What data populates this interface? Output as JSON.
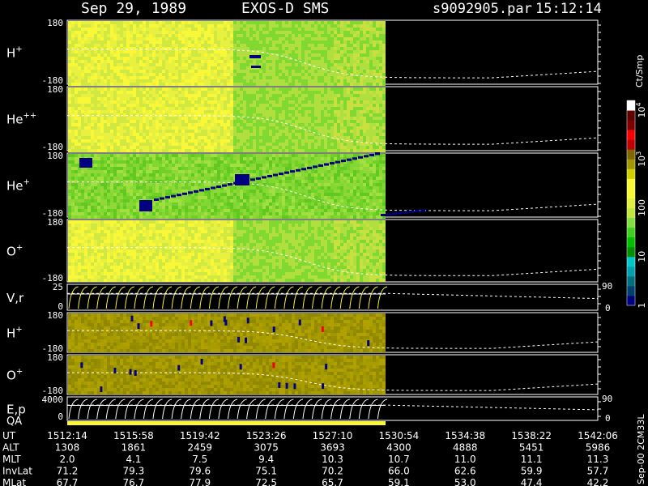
{
  "chart_data": {
    "type": "heatmap",
    "header": {
      "date": "Sep 29, 1989",
      "instrument": "EXOS-D SMS",
      "file": "s9092905.par",
      "time": "15:12:14"
    },
    "colorbar": {
      "label": "Ct/Smp",
      "ticks": [
        {
          "label": "1",
          "value": 1
        },
        {
          "label": "10",
          "value": 10
        },
        {
          "label": "100",
          "value": 100
        },
        {
          "label": "10",
          "sup": "3",
          "value": 1000
        },
        {
          "label": "10",
          "sup": "4",
          "value": 10000
        }
      ],
      "colors": [
        "#000080",
        "#004070",
        "#007080",
        "#00a0b0",
        "#00c8c8",
        "#009000",
        "#00c000",
        "#40d020",
        "#80e040",
        "#c0e840",
        "#e0f040",
        "#f8f838",
        "#f8f838",
        "#d0d000",
        "#a09800",
        "#806800",
        "#c00000",
        "#f80000",
        "#800000",
        "#600000",
        "#ffffff"
      ]
    },
    "panels": [
      {
        "id": "H+",
        "label": "H",
        "sup": "+",
        "ytop": "180",
        "ybot": "-180",
        "style": "yellow-green",
        "dense_dots": true
      },
      {
        "id": "He++",
        "label": "He",
        "sup": "++",
        "ytop": "180",
        "ybot": "-180",
        "style": "yellow-green"
      },
      {
        "id": "He+",
        "label": "He",
        "sup": "+",
        "ytop": "180",
        "ybot": "-180",
        "style": "green",
        "track": true
      },
      {
        "id": "O+",
        "label": "O",
        "sup": "+",
        "ytop": "180",
        "ybot": "-180",
        "style": "yellow-green"
      },
      {
        "id": "Vr",
        "label": "V,r",
        "sup": "",
        "ytop": "25",
        "ybot": "0",
        "style": "curves",
        "right_ticks": [
          "90",
          "0"
        ]
      },
      {
        "id": "H+b",
        "label": "H",
        "sup": "+",
        "ytop": "180",
        "ybot": "-180",
        "style": "olive"
      },
      {
        "id": "O+b",
        "label": "O",
        "sup": "+",
        "ytop": "180",
        "ybot": "-180",
        "style": "olive"
      },
      {
        "id": "Ep",
        "label": "E,p",
        "sup": "",
        "ytop": "4000",
        "ybot": "0",
        "style": "curves",
        "right_ticks": [
          "90",
          "0"
        ]
      }
    ],
    "qa_label": "QA",
    "data_end_fraction": 0.6,
    "side_label": "Sep-00  2CM33L",
    "table": {
      "rows": [
        {
          "name": "UT",
          "values": [
            "1512:14",
            "1515:58",
            "1519:42",
            "1523:26",
            "1527:10",
            "1530:54",
            "1534:38",
            "1538:22",
            "1542:06"
          ]
        },
        {
          "name": "ALT",
          "values": [
            "1308",
            "1861",
            "2459",
            "3075",
            "3693",
            "4300",
            "4888",
            "5451",
            "5986"
          ]
        },
        {
          "name": "MLT",
          "values": [
            "2.0",
            "4.1",
            "7.5",
            "9.4",
            "10.3",
            "10.7",
            "11.0",
            "11.1",
            "11.3"
          ]
        },
        {
          "name": "InvLat",
          "values": [
            "71.2",
            "79.3",
            "79.6",
            "75.1",
            "70.2",
            "66.0",
            "62.6",
            "59.9",
            "57.7"
          ]
        },
        {
          "name": "MLat",
          "values": [
            "67.7",
            "76.7",
            "77.9",
            "72.5",
            "65.7",
            "59.1",
            "53.0",
            "47.4",
            "42.2"
          ]
        }
      ]
    }
  }
}
